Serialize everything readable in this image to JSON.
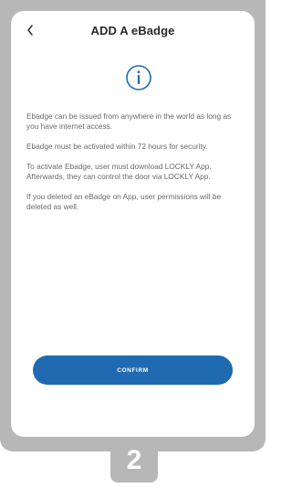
{
  "header": {
    "title": "ADD A eBadge"
  },
  "content": {
    "paragraphs": [
      "Ebadge can be issued from anywhere in the world as long as you have internet access.",
      "Ebadge must be activated within 72 hours for security.",
      "To activate Ebadge, user must download LOCKLY App. Afterwards, they can control the door via LOCKLY App.",
      "If you deleted an eBadge on App, user permissions will be deleted as well."
    ]
  },
  "actions": {
    "confirm_label": "CONFIRM"
  },
  "step": {
    "number": "2"
  },
  "colors": {
    "accent": "#1f6ab0",
    "frame": "#b7b7b7"
  },
  "icons": {
    "back": "chevron-left-icon",
    "info": "info-circle-icon"
  }
}
